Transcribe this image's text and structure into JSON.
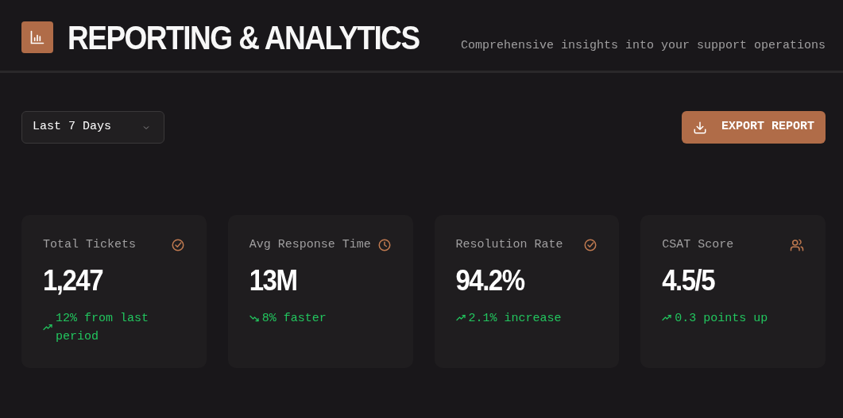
{
  "header": {
    "title": "REPORTING & ANALYTICS",
    "subtitle": "Comprehensive insights into your support operations"
  },
  "range_select": {
    "value": "Last 7 Days"
  },
  "export_button": {
    "label": "EXPORT REPORT"
  },
  "cards": [
    {
      "label": "Total Tickets",
      "kind": "check",
      "value": "1,247",
      "trending_up": true,
      "change": "12% from last period"
    },
    {
      "label": "Avg Response Time",
      "kind": "clock",
      "value": "13M",
      "trending_up": false,
      "change": "8% faster"
    },
    {
      "label": "Resolution Rate",
      "kind": "check",
      "value": "94.2%",
      "trending_up": true,
      "change": "2.1% increase"
    },
    {
      "label": "CSAT Score",
      "kind": "users",
      "value": "4.5/5",
      "trending_up": true,
      "change": "0.3 points up"
    }
  ]
}
